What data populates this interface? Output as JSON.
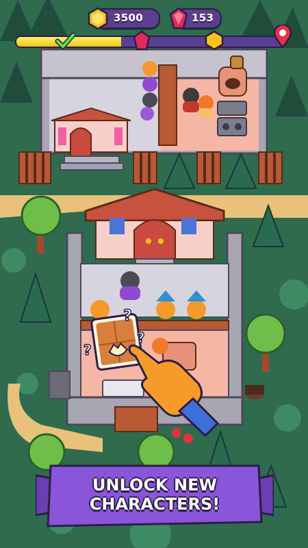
{
  "hud": {
    "coins": "3500",
    "gems": "153",
    "coin_icon": "hexagon-coin-icon",
    "gem_icon": "red-gem-icon"
  },
  "level_progress": {
    "fill_fraction": 0.39,
    "milestones": [
      {
        "icon": "check-icon",
        "state": "done"
      },
      {
        "icon": "red-gem-icon",
        "state": "pending"
      },
      {
        "icon": "hexagon-coin-icon",
        "state": "pending"
      },
      {
        "icon": "map-pin-icon",
        "state": "goal"
      }
    ]
  },
  "promo": {
    "line1": "UNLOCK NEW",
    "line2": "CHARACTERS!"
  },
  "colors": {
    "grass": "#2f6b4f",
    "path": "#e8c27a",
    "hud_purple": "#5b3f8f",
    "banner_purple": "#8a55d8",
    "roof_red": "#c9523f",
    "floor_pink": "#f6b6a6"
  }
}
